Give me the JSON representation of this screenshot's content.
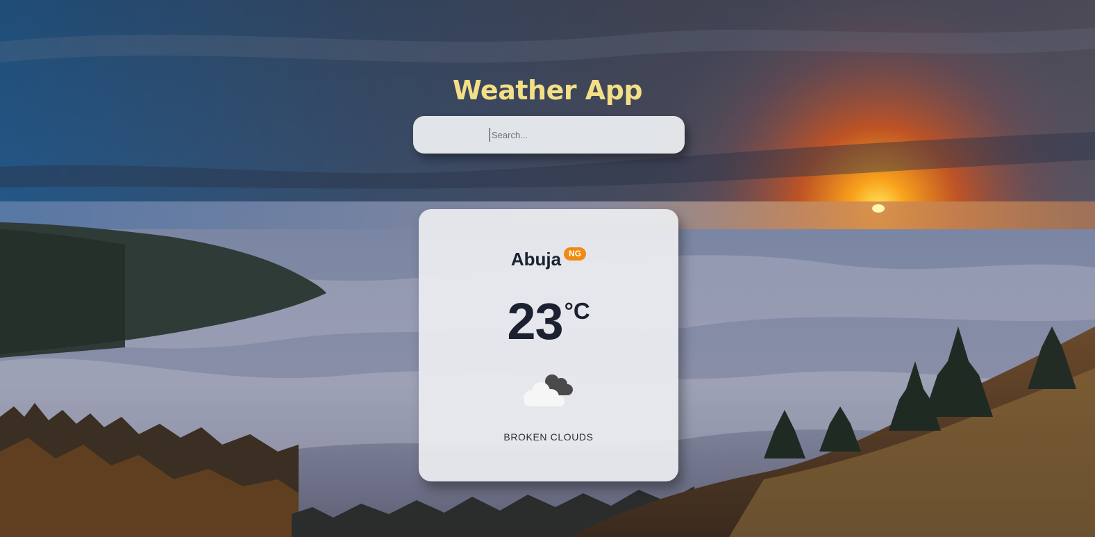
{
  "app": {
    "title": "Weather App"
  },
  "search": {
    "placeholder": "Search...",
    "value": ""
  },
  "weather": {
    "city": "Abuja",
    "country_code": "NG",
    "temperature": "23",
    "unit": "°C",
    "condition_icon": "broken-clouds-icon",
    "description": "BROKEN CLOUDS"
  },
  "colors": {
    "title": "#f3df86",
    "country_badge": "#f08a10",
    "text_dark": "#1b2130"
  }
}
